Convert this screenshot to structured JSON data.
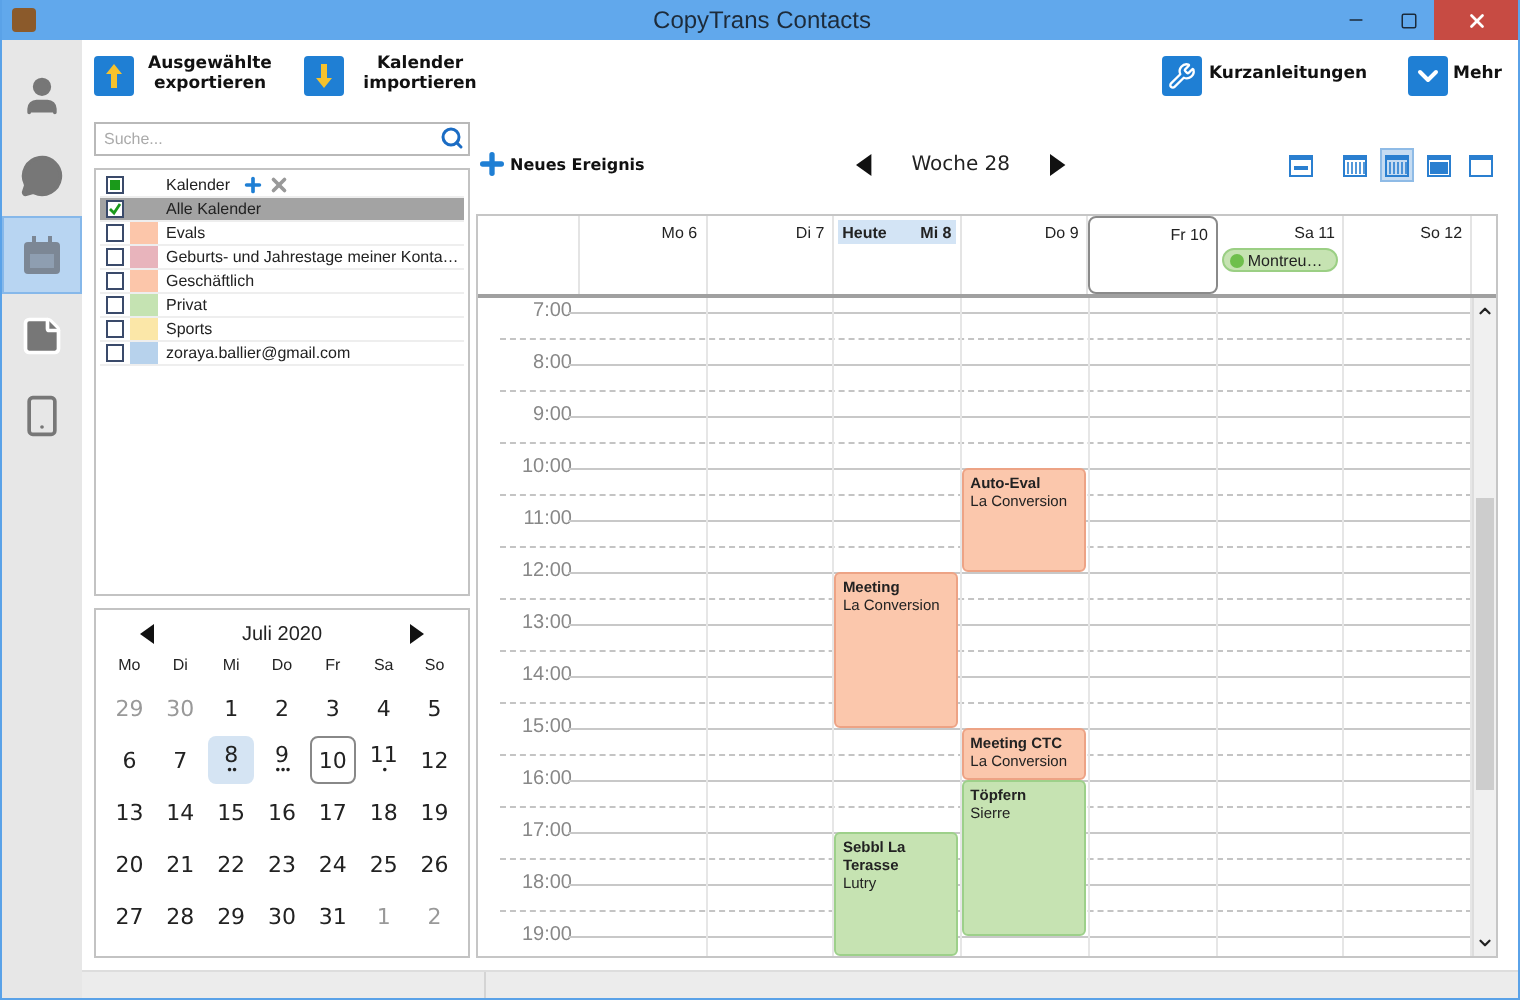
{
  "window": {
    "title": "CopyTrans Contacts"
  },
  "nav": [
    {
      "kind": "contacts",
      "selected": false
    },
    {
      "kind": "messages",
      "selected": false
    },
    {
      "kind": "calendar",
      "selected": true
    },
    {
      "kind": "notes",
      "selected": false
    },
    {
      "kind": "phone",
      "selected": false
    }
  ],
  "toolbar": {
    "left": [
      {
        "kind": "export",
        "label": "Ausgewählte exportieren"
      },
      {
        "kind": "import",
        "label": "Kalender importieren"
      }
    ],
    "right": [
      {
        "kind": "guides",
        "label": "Kurzanleitungen"
      },
      {
        "kind": "more",
        "label": "Mehr"
      }
    ]
  },
  "search": {
    "placeholder": "Suche..."
  },
  "calendars": {
    "header": {
      "label": "Kalender",
      "partial": true
    },
    "items": [
      {
        "name": "Alle Kalender",
        "checked": true,
        "selected": true
      },
      {
        "name": "Evals",
        "checked": false,
        "selected": false,
        "color": "#fcc6aa"
      },
      {
        "name": "Geburts- und Jahrestage meiner Konta…",
        "checked": false,
        "selected": false,
        "color": "#e8b4bc"
      },
      {
        "name": "Geschäftlich",
        "checked": false,
        "selected": false,
        "color": "#fcc6aa"
      },
      {
        "name": "Privat",
        "checked": false,
        "selected": false,
        "color": "#c5e3b2"
      },
      {
        "name": "Sports",
        "checked": false,
        "selected": false,
        "color": "#fbe7a8"
      },
      {
        "name": "zoraya.ballier@gmail.com",
        "checked": false,
        "selected": false,
        "color": "#b7d2ec"
      }
    ]
  },
  "mini_calendar": {
    "month": "Juli 2020",
    "weekdays": [
      "Mo",
      "Di",
      "Mi",
      "Do",
      "Fr",
      "Sa",
      "So"
    ],
    "weeks": [
      [
        {
          "day": "29",
          "muted": true,
          "selected": false,
          "focused": false
        },
        {
          "day": "30",
          "muted": true,
          "selected": false,
          "focused": false
        },
        {
          "day": "1",
          "muted": false,
          "selected": false,
          "focused": false
        },
        {
          "day": "2",
          "muted": false,
          "selected": false,
          "focused": false
        },
        {
          "day": "3",
          "muted": false,
          "selected": false,
          "focused": false
        },
        {
          "day": "4",
          "muted": false,
          "selected": false,
          "focused": false
        },
        {
          "day": "5",
          "muted": false,
          "selected": false,
          "focused": false
        }
      ],
      [
        {
          "day": "6",
          "muted": false,
          "selected": false,
          "focused": false
        },
        {
          "day": "7",
          "muted": false,
          "selected": false,
          "focused": false
        },
        {
          "day": "8",
          "muted": false,
          "selected": true,
          "focused": false,
          "dots": "••"
        },
        {
          "day": "9",
          "muted": false,
          "selected": false,
          "focused": false,
          "dots": "•••"
        },
        {
          "day": "10",
          "muted": false,
          "selected": false,
          "focused": true
        },
        {
          "day": "11",
          "muted": false,
          "selected": false,
          "focused": false,
          "dots": "•"
        },
        {
          "day": "12",
          "muted": false,
          "selected": false,
          "focused": false
        }
      ],
      [
        {
          "day": "13",
          "muted": false,
          "selected": false,
          "focused": false
        },
        {
          "day": "14",
          "muted": false,
          "selected": false,
          "focused": false
        },
        {
          "day": "15",
          "muted": false,
          "selected": false,
          "focused": false
        },
        {
          "day": "16",
          "muted": false,
          "selected": false,
          "focused": false
        },
        {
          "day": "17",
          "muted": false,
          "selected": false,
          "focused": false
        },
        {
          "day": "18",
          "muted": false,
          "selected": false,
          "focused": false
        },
        {
          "day": "19",
          "muted": false,
          "selected": false,
          "focused": false
        }
      ],
      [
        {
          "day": "20",
          "muted": false,
          "selected": false,
          "focused": false
        },
        {
          "day": "21",
          "muted": false,
          "selected": false,
          "focused": false
        },
        {
          "day": "22",
          "muted": false,
          "selected": false,
          "focused": false
        },
        {
          "day": "23",
          "muted": false,
          "selected": false,
          "focused": false
        },
        {
          "day": "24",
          "muted": false,
          "selected": false,
          "focused": false
        },
        {
          "day": "25",
          "muted": false,
          "selected": false,
          "focused": false
        },
        {
          "day": "26",
          "muted": false,
          "selected": false,
          "focused": false
        }
      ],
      [
        {
          "day": "27",
          "muted": false,
          "selected": false,
          "focused": false
        },
        {
          "day": "28",
          "muted": false,
          "selected": false,
          "focused": false
        },
        {
          "day": "29",
          "muted": false,
          "selected": false,
          "focused": false
        },
        {
          "day": "30",
          "muted": false,
          "selected": false,
          "focused": false
        },
        {
          "day": "31",
          "muted": false,
          "selected": false,
          "focused": false
        },
        {
          "day": "1",
          "muted": true,
          "selected": false,
          "focused": false
        },
        {
          "day": "2",
          "muted": true,
          "selected": false,
          "focused": false
        }
      ]
    ]
  },
  "new_event": {
    "label": "Neues Ereignis"
  },
  "week_nav": {
    "label": "Woche 28"
  },
  "views": [
    {
      "kind": "agenda",
      "selected": false
    },
    {
      "kind": "workweek",
      "selected": false
    },
    {
      "kind": "week",
      "selected": true
    },
    {
      "kind": "month",
      "selected": false
    },
    {
      "kind": "year",
      "selected": false
    }
  ],
  "week": {
    "hours": [
      "7:00",
      "8:00",
      "9:00",
      "10:00",
      "11:00",
      "12:00",
      "13:00",
      "14:00",
      "15:00",
      "16:00",
      "17:00",
      "18:00",
      "19:00"
    ],
    "days": [
      {
        "label": "Mo 6",
        "today": false,
        "focused": false
      },
      {
        "label": "Di 7",
        "today": false,
        "focused": false
      },
      {
        "label": "Mi 8",
        "today": true,
        "today_label": "Heute",
        "focused": false,
        "hour_cells": [
          {
            "kind": "empty"
          },
          {
            "kind": "empty"
          },
          {
            "kind": "empty"
          },
          {
            "kind": "empty"
          },
          {
            "kind": "empty"
          },
          {
            "kind": "event",
            "title": "Meeting",
            "location": "La Conversion",
            "color": "#fbc7ac"
          },
          {
            "kind": "continued"
          },
          {
            "kind": "continued"
          },
          {
            "kind": "empty"
          },
          {
            "kind": "empty"
          },
          {
            "kind": "event",
            "title": "Sebbl La Terasse",
            "location": "Lutry",
            "color": "#c6e3b2"
          },
          {
            "kind": "continued"
          },
          {
            "kind": "continued"
          }
        ]
      },
      {
        "label": "Do 9",
        "today": false,
        "focused": false,
        "hour_cells": [
          {
            "kind": "empty"
          },
          {
            "kind": "empty"
          },
          {
            "kind": "empty"
          },
          {
            "kind": "event",
            "title": "Auto-Eval",
            "location": "La Conversion",
            "color": "#fbc7ac"
          },
          {
            "kind": "continued"
          },
          {
            "kind": "empty"
          },
          {
            "kind": "empty"
          },
          {
            "kind": "empty"
          },
          {
            "kind": "event",
            "title": "Meeting CTC",
            "location": "La Conversion",
            "color": "#fbc7ac"
          },
          {
            "kind": "event",
            "title": "Töpfern",
            "location": "Sierre",
            "color": "#c6e3b2"
          },
          {
            "kind": "continued"
          },
          {
            "kind": "continued"
          },
          {
            "kind": "empty"
          }
        ]
      },
      {
        "label": "Fr 10",
        "today": false,
        "focused": true
      },
      {
        "label": "Sa 11",
        "today": false,
        "focused": false,
        "all_day": [
          {
            "title": "Montreu…",
            "color": "#c6e3b2"
          }
        ]
      },
      {
        "label": "So 12",
        "today": false,
        "focused": false
      }
    ]
  }
}
